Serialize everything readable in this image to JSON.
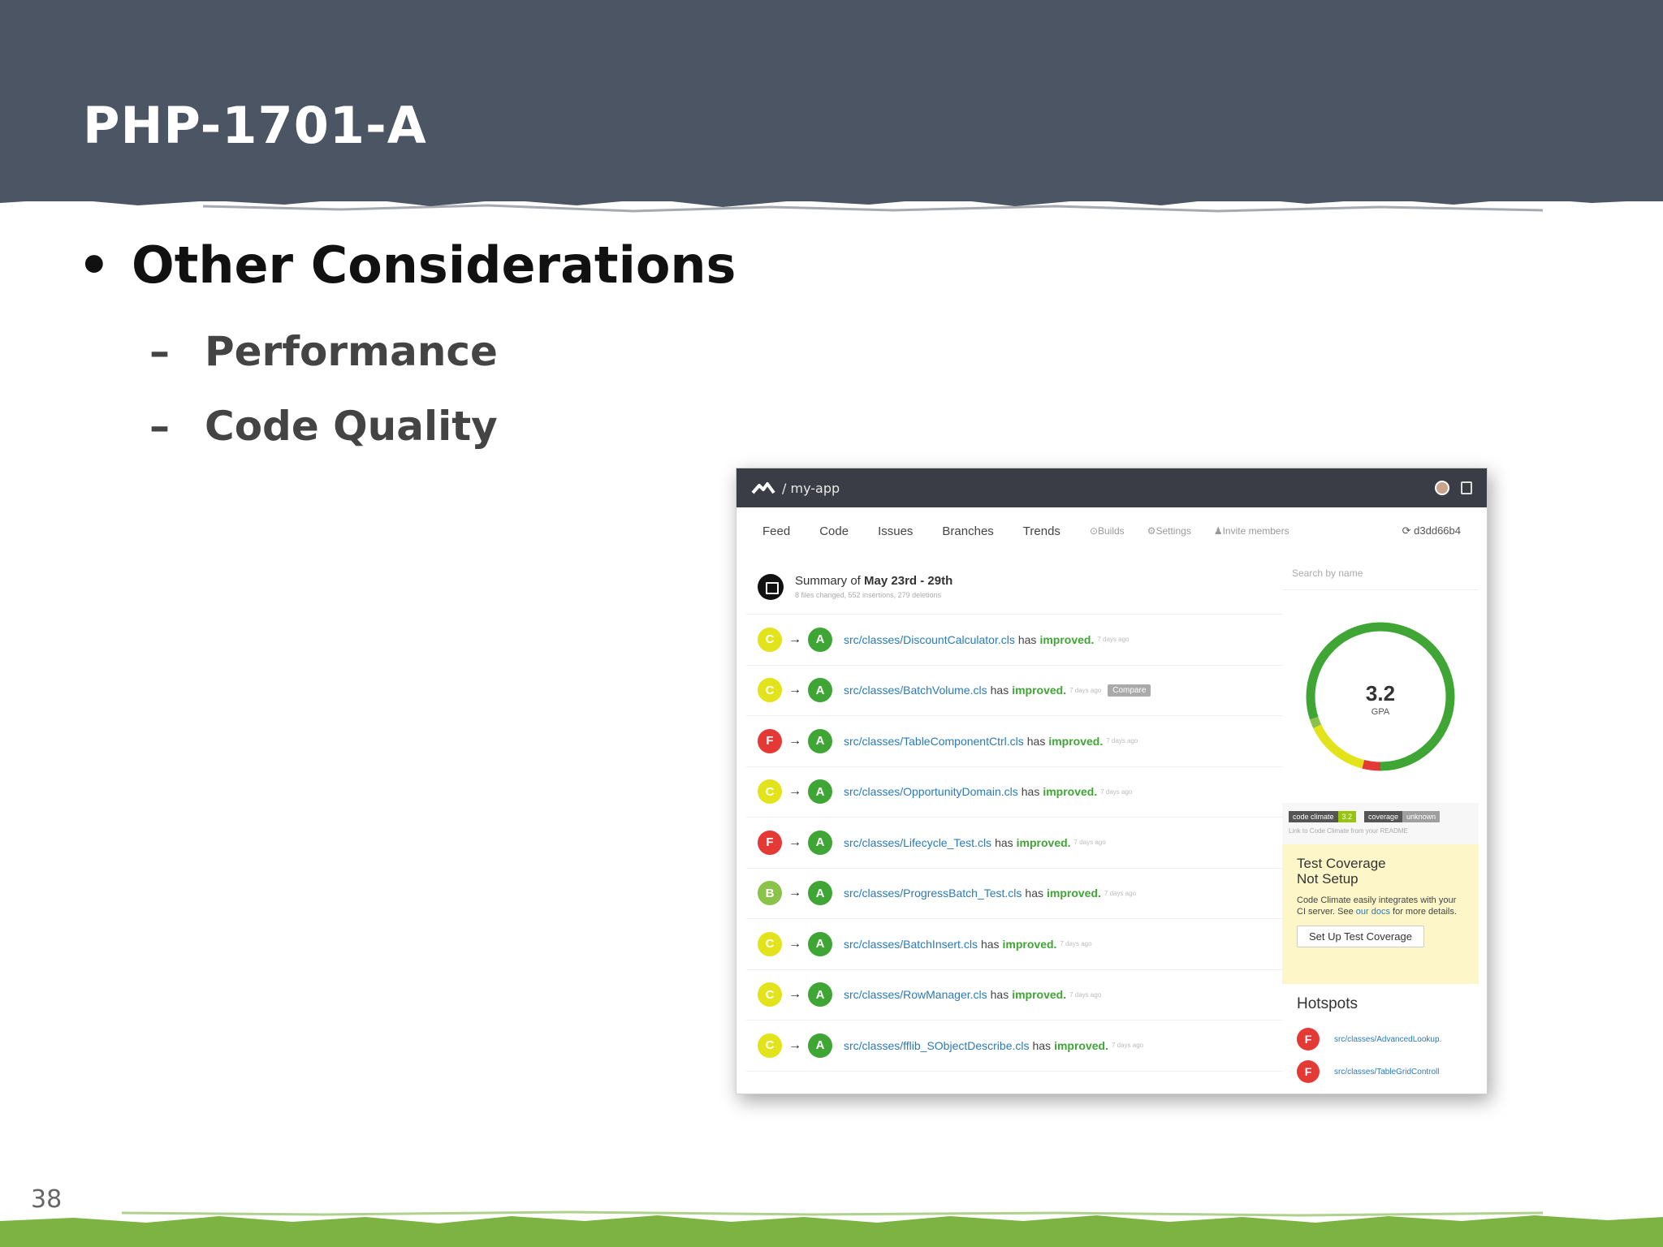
{
  "slide": {
    "title": "PHP-1701-A",
    "bullet": "Other Considerations",
    "subbullets": [
      "Performance",
      "Code Quality"
    ],
    "page_number": "38",
    "bullet_glyph": "•",
    "dash_glyph": "–"
  },
  "colors": {
    "header_band": "#4b5563",
    "footer_band": "#7cb342",
    "grade_a": "#3fa535",
    "grade_b": "#8bc34a",
    "grade_c": "#e3e31c",
    "grade_f": "#e53935"
  },
  "app": {
    "repo": "/ my-app",
    "nav": {
      "feed": "Feed",
      "code": "Code",
      "issues": "Issues",
      "branches": "Branches",
      "trends": "Trends",
      "builds": "Builds",
      "settings": "Settings",
      "invite": "Invite members",
      "commit": "d3dd66b4"
    },
    "summary": {
      "prefix": "Summary of",
      "range": "May 23rd - 29th",
      "detail": "8 files changed, 552 insertions, 279 deletions"
    },
    "feed": [
      {
        "from": "C",
        "to": "A",
        "path": "src/classes/DiscountCalculator.cls",
        "has": "has",
        "status": "improved.",
        "ago": "7 days ago"
      },
      {
        "from": "C",
        "to": "A",
        "path": "src/classes/BatchVolume.cls",
        "has": "has",
        "status": "improved.",
        "ago": "7 days ago",
        "action": "Compare"
      },
      {
        "from": "F",
        "to": "A",
        "path": "src/classes/TableComponentCtrl.cls",
        "has": "has",
        "status": "improved.",
        "ago": "7 days ago"
      },
      {
        "from": "C",
        "to": "A",
        "path": "src/classes/OpportunityDomain.cls",
        "has": "has",
        "status": "improved.",
        "ago": "7 days ago"
      },
      {
        "from": "F",
        "to": "A",
        "path": "src/classes/Lifecycle_Test.cls",
        "has": "has",
        "status": "improved.",
        "ago": "7 days ago"
      },
      {
        "from": "B",
        "to": "A",
        "path": "src/classes/ProgressBatch_Test.cls",
        "has": "has",
        "status": "improved.",
        "ago": "7 days ago"
      },
      {
        "from": "C",
        "to": "A",
        "path": "src/classes/BatchInsert.cls",
        "has": "has",
        "status": "improved.",
        "ago": "7 days ago"
      },
      {
        "from": "C",
        "to": "A",
        "path": "src/classes/RowManager.cls",
        "has": "has",
        "status": "improved.",
        "ago": "7 days ago"
      },
      {
        "from": "C",
        "to": "A",
        "path": "src/classes/fflib_SObjectDescribe.cls",
        "has": "has",
        "status": "improved.",
        "ago": "7 days ago"
      }
    ],
    "arrow": "→",
    "search_placeholder": "Search by name",
    "gpa": {
      "value": "3.2",
      "label": "GPA",
      "ring": [
        {
          "grade": "A",
          "fraction": 0.8
        },
        {
          "grade": "B",
          "fraction": 0.02
        },
        {
          "grade": "C",
          "fraction": 0.14
        },
        {
          "grade": "F",
          "fraction": 0.04
        }
      ]
    },
    "badges": {
      "cc_key": "code climate",
      "cc_val": "3.2",
      "cov_key": "coverage",
      "cov_val": "unknown",
      "link": "Link to Code Climate from your README"
    },
    "coverage": {
      "title_line1": "Test Coverage",
      "title_line2": "Not Setup",
      "desc_before": "Code Climate easily integrates with your CI server. See",
      "desc_link": "our docs",
      "desc_after": "for more details.",
      "button": "Set Up Test Coverage"
    },
    "hotspots": {
      "title": "Hotspots",
      "items": [
        {
          "grade": "F",
          "path": "src/classes/AdvancedLookup."
        },
        {
          "grade": "F",
          "path": "src/classes/TableGridControll"
        }
      ]
    }
  }
}
